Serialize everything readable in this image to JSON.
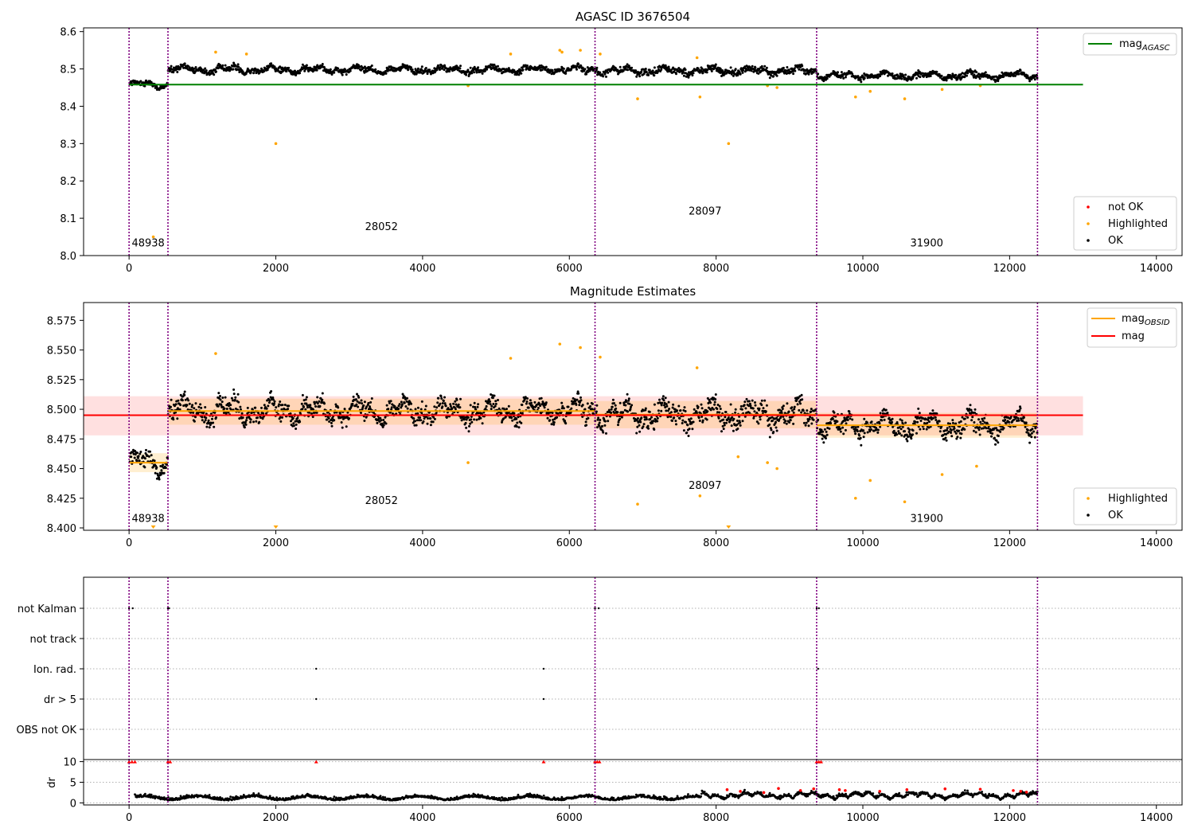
{
  "chart_data": [
    {
      "type": "scatter",
      "title": "AGASC ID 3676504",
      "xlim": [
        -620,
        14350
      ],
      "ylim": [
        8.0,
        8.61
      ],
      "x_ticks": [
        "0",
        "2000",
        "4000",
        "6000",
        "8000",
        "10000",
        "12000",
        "14000"
      ],
      "y_ticks": [
        "8.0",
        "8.1",
        "8.2",
        "8.3",
        "8.4",
        "8.5",
        "8.6"
      ],
      "obsid_boundaries": [
        0,
        530,
        6350,
        9370,
        12380
      ],
      "obsid_labels": [
        {
          "text": "48938",
          "x": 260,
          "y": 8.025
        },
        {
          "text": "28052",
          "x": 3440,
          "y": 8.068
        },
        {
          "text": "28097",
          "x": 7850,
          "y": 8.11
        },
        {
          "text": "31900",
          "x": 10870,
          "y": 8.025
        }
      ],
      "reference_lines": [
        {
          "name": "mag_AGASC",
          "y": 8.458,
          "x_range": [
            0,
            13000
          ],
          "color": "#008000"
        }
      ],
      "segments": [
        {
          "x_range": [
            0,
            530
          ],
          "mean": 8.458,
          "sigma": 0.008
        },
        {
          "x_range": [
            530,
            6350
          ],
          "mean": 8.498,
          "sigma": 0.011
        },
        {
          "x_range": [
            6350,
            9370
          ],
          "mean": 8.495,
          "sigma": 0.012
        },
        {
          "x_range": [
            9370,
            12380
          ],
          "mean": 8.482,
          "sigma": 0.01
        }
      ],
      "highlighted_points": [
        {
          "x": 330,
          "y": 8.05
        },
        {
          "x": 2000,
          "y": 8.3
        },
        {
          "x": 8170,
          "y": 8.3
        },
        {
          "x": 6930,
          "y": 8.42
        },
        {
          "x": 7780,
          "y": 8.425
        },
        {
          "x": 9900,
          "y": 8.425
        },
        {
          "x": 10100,
          "y": 8.44
        },
        {
          "x": 10570,
          "y": 8.42
        },
        {
          "x": 11080,
          "y": 8.445
        },
        {
          "x": 4620,
          "y": 8.455
        },
        {
          "x": 1180,
          "y": 8.545
        },
        {
          "x": 5200,
          "y": 8.54
        },
        {
          "x": 5870,
          "y": 8.55
        },
        {
          "x": 5900,
          "y": 8.545
        },
        {
          "x": 6150,
          "y": 8.55
        },
        {
          "x": 6420,
          "y": 8.54
        },
        {
          "x": 1600,
          "y": 8.54
        },
        {
          "x": 7740,
          "y": 8.53
        },
        {
          "x": 8700,
          "y": 8.455
        },
        {
          "x": 8830,
          "y": 8.45
        },
        {
          "x": 11600,
          "y": 8.455
        }
      ],
      "legends": [
        {
          "position": "top-right",
          "entries": [
            {
              "label": "mag",
              "subscript": "AGASC",
              "color": "#008000",
              "marker": "line"
            }
          ]
        },
        {
          "position": "lower-right",
          "entries": [
            {
              "label": "not OK",
              "color": "#ff0000",
              "marker": "dot"
            },
            {
              "label": "Highlighted",
              "color": "#ffa500",
              "marker": "dot"
            },
            {
              "label": "OK",
              "color": "#000000",
              "marker": "dot"
            }
          ]
        }
      ]
    },
    {
      "type": "scatter",
      "title": "Magnitude Estimates",
      "xlim": [
        -620,
        14350
      ],
      "ylim": [
        8.398,
        8.59
      ],
      "x_ticks": [
        "0",
        "2000",
        "4000",
        "6000",
        "8000",
        "10000",
        "12000",
        "14000"
      ],
      "y_ticks": [
        "8.400",
        "8.425",
        "8.450",
        "8.475",
        "8.500",
        "8.525",
        "8.550",
        "8.575"
      ],
      "y_tick_values": [
        8.4,
        8.425,
        8.45,
        8.475,
        8.5,
        8.525,
        8.55,
        8.575
      ],
      "obsid_boundaries": [
        0,
        530,
        6350,
        9370,
        12380
      ],
      "obsid_labels": [
        {
          "text": "48938",
          "x": 260,
          "y": 8.405
        },
        {
          "text": "28052",
          "x": 3440,
          "y": 8.42
        },
        {
          "text": "28097",
          "x": 7850,
          "y": 8.433
        },
        {
          "text": "31900",
          "x": 10870,
          "y": 8.405
        }
      ],
      "mag_line": {
        "name": "mag",
        "y": 8.495,
        "band": [
          8.478,
          8.511
        ],
        "x_range": [
          -620,
          13000
        ],
        "color": "#ff0000"
      },
      "obsid_mags": [
        {
          "x_range": [
            0,
            530
          ],
          "y": 8.455,
          "band": [
            8.447,
            8.463
          ]
        },
        {
          "x_range": [
            530,
            6350
          ],
          "y": 8.4985,
          "band": [
            8.487,
            8.509
          ]
        },
        {
          "x_range": [
            6350,
            9370
          ],
          "y": 8.4955,
          "band": [
            8.484,
            8.507
          ]
        },
        {
          "x_range": [
            9370,
            12380
          ],
          "y": 8.4865,
          "band": [
            8.476,
            8.497
          ]
        }
      ],
      "highlighted_points": [
        {
          "x": 330,
          "y": 8.4
        },
        {
          "x": 2000,
          "y": 8.4
        },
        {
          "x": 8170,
          "y": 8.4
        },
        {
          "x": 4620,
          "y": 8.455
        },
        {
          "x": 6930,
          "y": 8.42
        },
        {
          "x": 7780,
          "y": 8.427
        },
        {
          "x": 9900,
          "y": 8.425
        },
        {
          "x": 10100,
          "y": 8.44
        },
        {
          "x": 10570,
          "y": 8.422
        },
        {
          "x": 11080,
          "y": 8.445
        },
        {
          "x": 11550,
          "y": 8.452
        },
        {
          "x": 1180,
          "y": 8.547
        },
        {
          "x": 5200,
          "y": 8.543
        },
        {
          "x": 5870,
          "y": 8.555
        },
        {
          "x": 6150,
          "y": 8.552
        },
        {
          "x": 6420,
          "y": 8.544
        },
        {
          "x": 7740,
          "y": 8.535
        },
        {
          "x": 8700,
          "y": 8.455
        },
        {
          "x": 8830,
          "y": 8.45
        },
        {
          "x": 8300,
          "y": 8.46
        }
      ],
      "legends": [
        {
          "position": "top-right",
          "entries": [
            {
              "label": "mag",
              "subscript": "OBSID",
              "color": "#ffa500",
              "marker": "line"
            },
            {
              "label": "mag",
              "subscript": "",
              "color": "#ff0000",
              "marker": "line"
            }
          ]
        },
        {
          "position": "lower-right",
          "entries": [
            {
              "label": "Highlighted",
              "color": "#ffa500",
              "marker": "dot"
            },
            {
              "label": "OK",
              "color": "#000000",
              "marker": "dot"
            }
          ]
        }
      ]
    },
    {
      "type": "scatter",
      "title": "",
      "xlim": [
        -620,
        14350
      ],
      "categories": [
        "not Kalman",
        "not track",
        "Ion. rad.",
        "dr > 5",
        "OBS not OK"
      ],
      "flags": [
        {
          "category": "not Kalman",
          "x": [
            0,
            50,
            530,
            545,
            6350,
            6400,
            9370,
            9400
          ]
        },
        {
          "category": "Ion. rad.",
          "x": [
            2550,
            5650,
            9390
          ]
        },
        {
          "category": "dr > 5",
          "x": [
            2550,
            5650
          ]
        }
      ],
      "obsid_boundaries": [
        0,
        530,
        6350,
        9370,
        12380
      ]
    },
    {
      "type": "scatter",
      "title": "",
      "ylabel": "dr",
      "xlim": [
        -620,
        14350
      ],
      "ylim": [
        -0.5,
        10.5
      ],
      "x_ticks": [
        "0",
        "2000",
        "4000",
        "6000",
        "8000",
        "10000",
        "12000",
        "14000"
      ],
      "y_ticks": [
        "0",
        "5",
        "10"
      ],
      "y_tick_values": [
        0,
        5,
        10
      ],
      "capped_points_at_10": [
        0,
        40,
        80,
        530,
        560,
        2550,
        5650,
        6350,
        6380,
        6410,
        9370,
        9400,
        9430
      ],
      "red_points": [
        {
          "x": 8150,
          "y": 3.2
        },
        {
          "x": 8330,
          "y": 2.8
        },
        {
          "x": 8650,
          "y": 2.5
        },
        {
          "x": 8850,
          "y": 3.5
        },
        {
          "x": 9150,
          "y": 3.0
        },
        {
          "x": 9330,
          "y": 3.4
        },
        {
          "x": 9680,
          "y": 3.2
        },
        {
          "x": 9760,
          "y": 3.0
        },
        {
          "x": 10230,
          "y": 2.8
        },
        {
          "x": 10600,
          "y": 3.2
        },
        {
          "x": 11120,
          "y": 3.4
        },
        {
          "x": 11600,
          "y": 3.3
        },
        {
          "x": 12050,
          "y": 3.0
        },
        {
          "x": 12150,
          "y": 2.8
        },
        {
          "x": 12230,
          "y": 2.6
        }
      ],
      "obsid_boundaries": [
        0,
        530,
        6350,
        9370,
        12380
      ]
    }
  ]
}
